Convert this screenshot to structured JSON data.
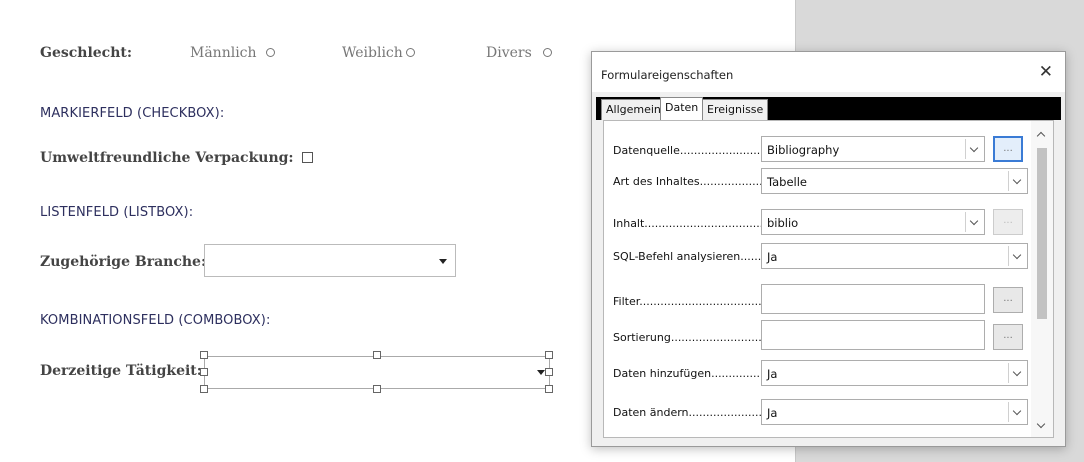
{
  "document": {
    "gender": {
      "label": "Geschlecht",
      "colon": ":",
      "options": [
        "Männlich",
        "Weiblich",
        "Divers"
      ]
    },
    "checkbox_heading": "MARKIERFELD (CHECKBOX):",
    "checkbox_label": "Umweltfreundliche Verpackung:",
    "listbox_heading": "LISTENFELD (LISTBOX):",
    "listbox_label": "Zugehörige Branche:",
    "combobox_heading": "KOMBINATIONSFELD (COMBOBOX):",
    "combobox_label": "Derzeitige Tätigkeit:"
  },
  "dialog": {
    "title": "Formulareigenschaften",
    "close_glyph": "✕",
    "tabs": [
      "Allgemein",
      "Daten",
      "Ereignisse"
    ],
    "active_tab": "Daten",
    "rows": [
      {
        "label": "Datenquelle.......................",
        "value": "Bibliography",
        "button": "..."
      },
      {
        "label": "Art des Inhaltes...................",
        "value": "Tabelle"
      },
      {
        "label": "Inhalt.....................................",
        "value": "biblio",
        "button": "..."
      },
      {
        "label": "SQL-Befehl analysieren......",
        "value": "Ja"
      },
      {
        "label": "Filter.........................................",
        "value": "",
        "button": "..."
      },
      {
        "label": "Sortierung...............................",
        "value": "",
        "button": "..."
      },
      {
        "label": "Daten hinzufügen...............",
        "value": "Ja"
      },
      {
        "label": "Daten ändern.......................",
        "value": "Ja"
      }
    ]
  },
  "icons": {
    "radio": "radio-icon",
    "checkbox": "checkbox-icon",
    "dropdown": "chevron-down-icon",
    "close": "close-icon"
  },
  "colors": {
    "heading": "#2d2f5e",
    "focus": "#3a7bd5",
    "workspace": "#d9d9d9"
  }
}
